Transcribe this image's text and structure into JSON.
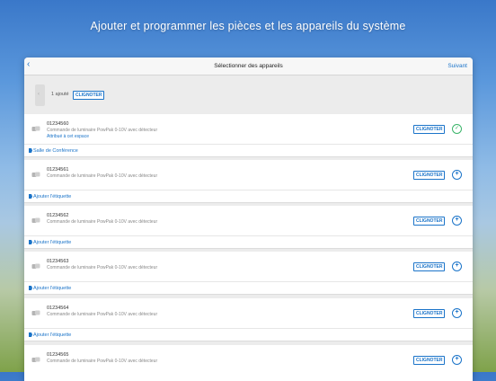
{
  "hero_title": "Ajouter et programmer les pièces et les appareils du système",
  "navbar": {
    "title": "Sélectionner des appareils",
    "next_label": "Suivant"
  },
  "summary": {
    "count_label": "1 ajouté",
    "button_label": "CLIGNOTER"
  },
  "accent_color": "#1b74c9",
  "success_color": "#3bb56a",
  "devices": [
    {
      "serial": "01234560",
      "description": "Commande de luminaire PowPak 0-10V avec détecteur",
      "area": "Attribué à cet espace",
      "button": "CLIGNOTER",
      "state": "added",
      "tag": "Salle de Conférence"
    },
    {
      "serial": "01234561",
      "description": "Commande de luminaire PowPak 0-10V avec détecteur",
      "button": "CLIGNOTER",
      "state": "add",
      "tag": "Ajouter l'étiquette"
    },
    {
      "serial": "01234562",
      "description": "Commande de luminaire PowPak 0-10V avec détecteur",
      "button": "CLIGNOTER",
      "state": "add",
      "tag": "Ajouter l'étiquette"
    },
    {
      "serial": "01234563",
      "description": "Commande de luminaire PowPak 0-10V avec détecteur",
      "button": "CLIGNOTER",
      "state": "add",
      "tag": "Ajouter l'étiquette"
    },
    {
      "serial": "01234564",
      "description": "Commande de luminaire PowPak 0-10V avec détecteur",
      "button": "CLIGNOTER",
      "state": "add",
      "tag": "Ajouter l'étiquette"
    },
    {
      "serial": "01234565",
      "description": "Commande de luminaire PowPak 0-10V avec détecteur",
      "button": "CLIGNOTER",
      "state": "add",
      "tag": ""
    }
  ]
}
